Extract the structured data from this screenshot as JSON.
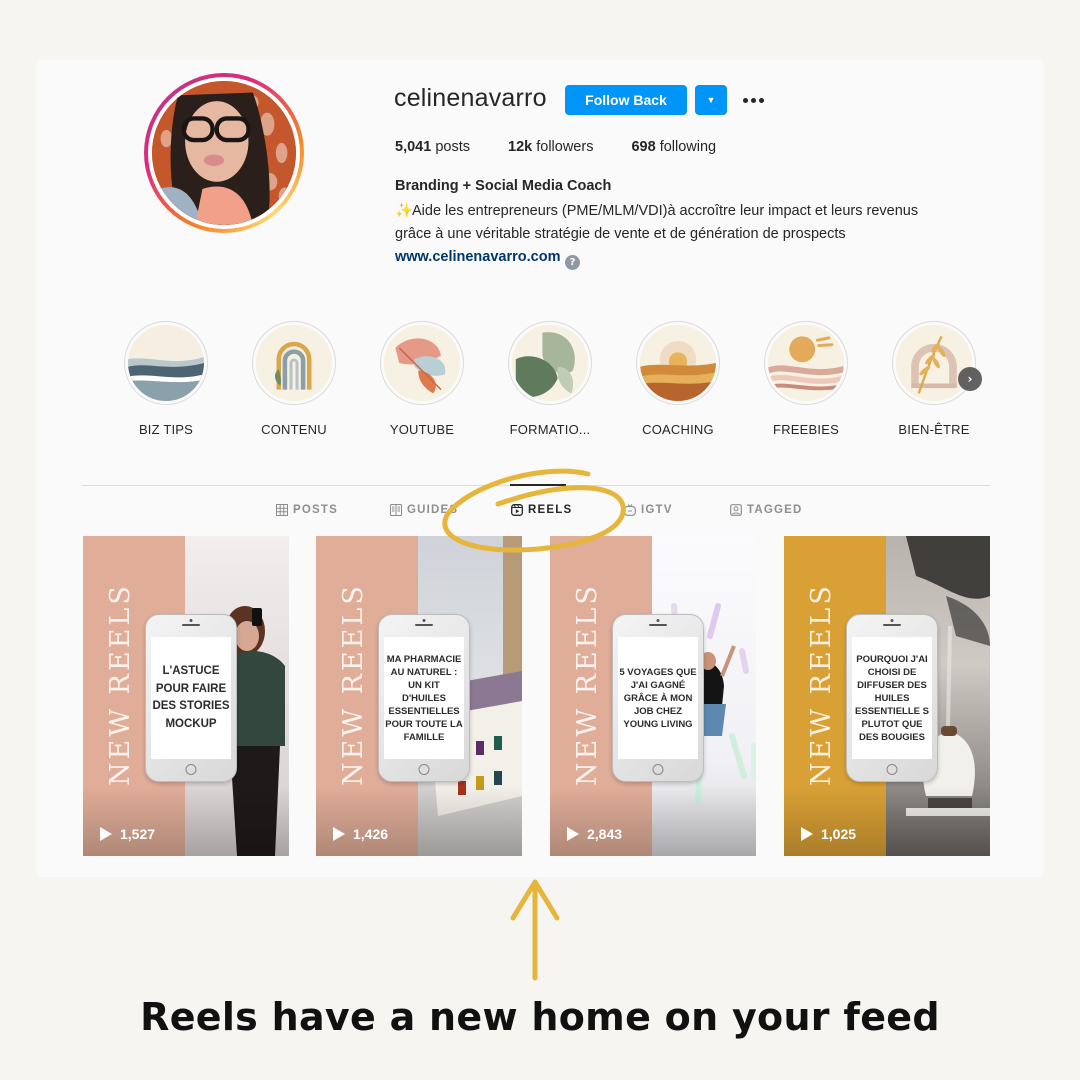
{
  "profile": {
    "username": "celinenavarro",
    "follow_label": "Follow Back",
    "dropdown_glyph": "▼",
    "stats": [
      {
        "value": "5,041",
        "label": "posts"
      },
      {
        "value": "12k",
        "label": "followers"
      },
      {
        "value": "698",
        "label": "following"
      }
    ],
    "bio_name": "Branding + Social Media Coach",
    "bio_emoji": "✨",
    "bio_line1": "Aide les entrepreneurs (PME/MLM/VDI)à accroître leur impact et leurs revenus",
    "bio_line2": "grâce à une véritable stratégie de vente et de génération de prospects",
    "website": "www.celinenavarro.com",
    "help_glyph": "?"
  },
  "highlights": [
    {
      "label": "BIZ TIPS",
      "icon": "waves-icon"
    },
    {
      "label": "CONTENU",
      "icon": "rainbow-icon"
    },
    {
      "label": "YOUTUBE",
      "icon": "monstera-leaf-icon"
    },
    {
      "label": "FORMATIO...",
      "icon": "leaves-icon"
    },
    {
      "label": "COACHING",
      "icon": "sunset-dunes-icon"
    },
    {
      "label": "FREEBIES",
      "icon": "sun-waves-icon"
    },
    {
      "label": "BIEN-ÊTRE",
      "icon": "branch-arch-icon"
    }
  ],
  "highlights_next_glyph": "›",
  "tabs": [
    {
      "label": "POSTS",
      "icon": "grid-icon",
      "active": false
    },
    {
      "label": "GUIDES",
      "icon": "guides-icon",
      "active": false
    },
    {
      "label": "REELS",
      "icon": "reels-icon",
      "active": true
    },
    {
      "label": "IGTV",
      "icon": "igtv-icon",
      "active": false
    },
    {
      "label": "TAGGED",
      "icon": "tagged-icon",
      "active": false
    }
  ],
  "reels": [
    {
      "overlay": "NEW REELS",
      "phone_text": "L'ASTUCE POUR FAIRE DES STORIES MOCKUP",
      "views": "1,527",
      "strip_color": "#e0ad98"
    },
    {
      "overlay": "NEW REELS",
      "phone_text": "MA PHARMACIE AU NATUREL : UN KIT D'HUILES ESSENTIELLES POUR TOUTE LA FAMILLE",
      "views": "1,426",
      "strip_color": "#e0ad98"
    },
    {
      "overlay": "NEW REELS",
      "phone_text": "5 VOYAGES QUE J'AI GAGNÉ GRÂCE À MON JOB CHEZ YOUNG LIVING",
      "views": "2,843",
      "strip_color": "#e0ad98"
    },
    {
      "overlay": "NEW REELS",
      "phone_text": "POURQUOI J'AI CHOISI DE DIFFUSER DES HUILES ESSENTIELLE S PLUTOT QUE DES BOUGIES",
      "views": "1,025",
      "strip_color": "#d9a035"
    }
  ],
  "caption": "Reels have a new home on your feed",
  "colors": {
    "accent_blue": "#0095f6",
    "annotation_gold": "#e6b53c",
    "link_blue": "#00376b",
    "background": "#f6f5f2"
  }
}
